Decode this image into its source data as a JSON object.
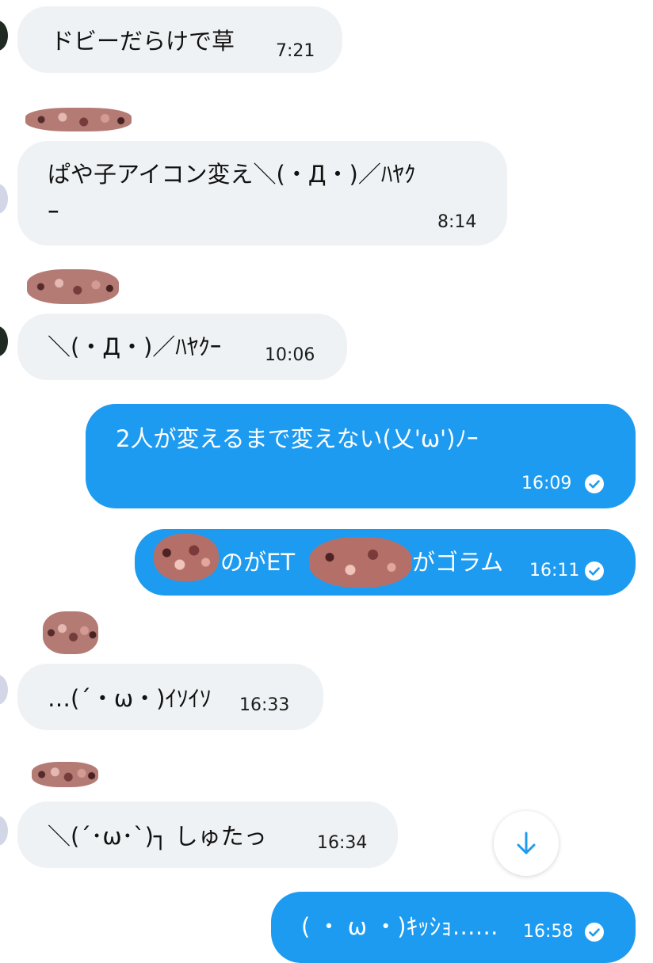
{
  "messages": [
    {
      "direction": "incoming",
      "text": "ドビーだらけで草",
      "time": "7:21"
    },
    {
      "direction": "incoming",
      "text_line1": "ぱや子アイコン変え＼(・Д・)／ﾊﾔｸ",
      "text_line2": "ｰ",
      "time": "8:14"
    },
    {
      "direction": "incoming",
      "text": "＼(・Д・)／ﾊﾔｸｰ",
      "time": "10:06"
    },
    {
      "direction": "outgoing",
      "text": "2人が変えるまで変えない(乂'ω')ﾉｰ",
      "time": "16:09",
      "status_icon": "check-circle-icon"
    },
    {
      "direction": "outgoing",
      "text_part1": "のがET",
      "text_part2": "がゴラム",
      "time": "16:11",
      "status_icon": "check-circle-icon"
    },
    {
      "direction": "incoming",
      "text": "…(´・ω・)ｲｿｲｿ",
      "time": "16:33"
    },
    {
      "direction": "incoming",
      "text": "＼(´･ω･`)┐ しゅたっ",
      "time": "16:34"
    },
    {
      "direction": "outgoing",
      "text": "( ・ ω ・)ｷｯｼｮ……",
      "time": "16:58",
      "status_icon": "check-circle-icon"
    }
  ],
  "scroll_button": {
    "icon": "arrow-down-icon"
  },
  "colors": {
    "incoming_bubble": "#eff2f4",
    "outgoing_bubble": "#1d9bf0",
    "accent": "#1d9bf0",
    "text": "#111111",
    "redaction": "#b97a72"
  }
}
